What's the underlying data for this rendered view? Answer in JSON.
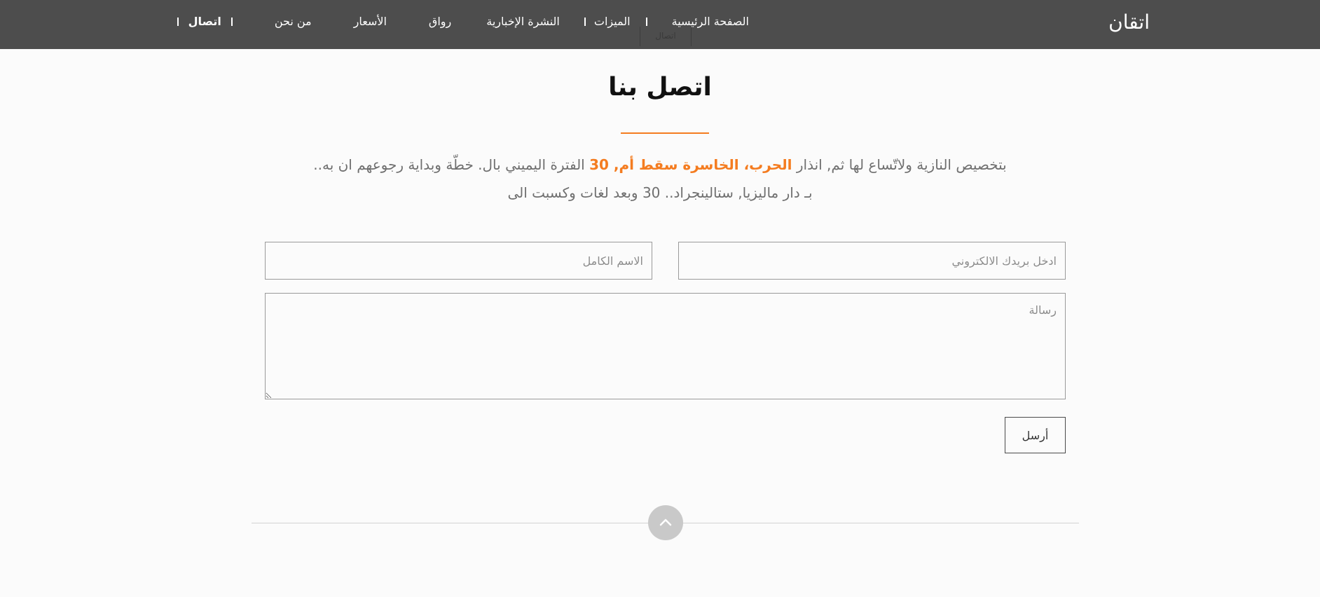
{
  "navbar": {
    "brand": "اتقان",
    "items": [
      {
        "label": "الصفحة الرئيسية"
      },
      {
        "label": "الميزات"
      },
      {
        "label": "النشرة الإخبارية"
      },
      {
        "label": "رواق"
      },
      {
        "label": "الأسعار"
      },
      {
        "label": "من نحن"
      },
      {
        "label": "اتصال"
      }
    ],
    "submenu_peek": "اتصال"
  },
  "contact": {
    "title": "اتصل بنا",
    "intro_part1": "بتخصيص النازية ولاتّساع لها ثم, انذار ",
    "intro_highlight": "الحرب، الخاسرة سقط أم, 30",
    "intro_part2": " الفترة اليميني بال. خطّة وبداية رجوعهم ان به.. بـ دار ماليزيا, ستالينجراد.. 30 وبعد لغات وكسبت الى",
    "email_placeholder": "ادخل بريدك الالكتروني",
    "name_placeholder": "الاسم الكامل",
    "message_placeholder": "رسالة",
    "send_label": "أرسل"
  },
  "icons": {
    "scroll_top": "chevron-up-icon"
  },
  "colors": {
    "navbar_bg": "#4d4d4d",
    "accent": "#f47c20"
  }
}
